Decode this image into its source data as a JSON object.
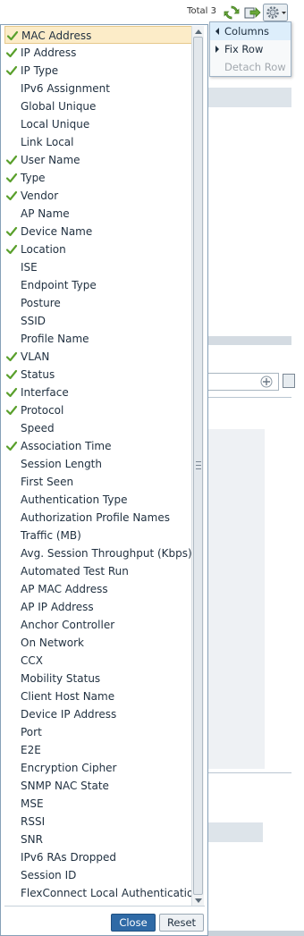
{
  "toolbar": {
    "total_label": "Total 3",
    "icons": [
      "refresh-icon",
      "export-icon",
      "gear-icon"
    ]
  },
  "colors": {
    "check": "#5aa02c",
    "selected_row": "#fcecc8",
    "close_button": "#2f6aa6",
    "menu_highlight": "#ddeefb"
  },
  "menu": {
    "items": [
      {
        "label": "Columns",
        "state": "active"
      },
      {
        "label": "Fix Row",
        "state": "normal"
      },
      {
        "label": "Detach Row",
        "state": "disabled"
      }
    ]
  },
  "columns": [
    {
      "label": "MAC Address",
      "checked": true,
      "selected": true
    },
    {
      "label": "IP Address",
      "checked": true
    },
    {
      "label": "IP Type",
      "checked": true
    },
    {
      "label": "IPv6 Assignment",
      "checked": false
    },
    {
      "label": "Global Unique",
      "checked": false
    },
    {
      "label": "Local Unique",
      "checked": false
    },
    {
      "label": "Link Local",
      "checked": false
    },
    {
      "label": "User Name",
      "checked": true
    },
    {
      "label": "Type",
      "checked": true
    },
    {
      "label": "Vendor",
      "checked": true
    },
    {
      "label": "AP Name",
      "checked": false
    },
    {
      "label": "Device Name",
      "checked": true
    },
    {
      "label": "Location",
      "checked": true
    },
    {
      "label": "ISE",
      "checked": false
    },
    {
      "label": "Endpoint Type",
      "checked": false
    },
    {
      "label": "Posture",
      "checked": false
    },
    {
      "label": "SSID",
      "checked": false
    },
    {
      "label": "Profile Name",
      "checked": false
    },
    {
      "label": "VLAN",
      "checked": true
    },
    {
      "label": "Status",
      "checked": true
    },
    {
      "label": "Interface",
      "checked": true
    },
    {
      "label": "Protocol",
      "checked": true
    },
    {
      "label": "Speed",
      "checked": false
    },
    {
      "label": "Association Time",
      "checked": true
    },
    {
      "label": "Session Length",
      "checked": false
    },
    {
      "label": "First Seen",
      "checked": false
    },
    {
      "label": "Authentication Type",
      "checked": false
    },
    {
      "label": "Authorization Profile Names",
      "checked": false
    },
    {
      "label": "Traffic (MB)",
      "checked": false
    },
    {
      "label": "Avg. Session Throughput (Kbps)",
      "checked": false
    },
    {
      "label": "Automated Test Run",
      "checked": false
    },
    {
      "label": "AP MAC Address",
      "checked": false
    },
    {
      "label": "AP IP Address",
      "checked": false
    },
    {
      "label": "Anchor Controller",
      "checked": false
    },
    {
      "label": "On Network",
      "checked": false
    },
    {
      "label": "CCX",
      "checked": false
    },
    {
      "label": "Mobility Status",
      "checked": false
    },
    {
      "label": "Client Host Name",
      "checked": false
    },
    {
      "label": "Device IP Address",
      "checked": false
    },
    {
      "label": "Port",
      "checked": false
    },
    {
      "label": "E2E",
      "checked": false
    },
    {
      "label": "Encryption Cipher",
      "checked": false
    },
    {
      "label": "SNMP NAC State",
      "checked": false
    },
    {
      "label": "MSE",
      "checked": false
    },
    {
      "label": "RSSI",
      "checked": false
    },
    {
      "label": "SNR",
      "checked": false
    },
    {
      "label": "IPv6 RAs Dropped",
      "checked": false
    },
    {
      "label": "Session ID",
      "checked": false
    },
    {
      "label": "FlexConnect Local Authentication",
      "checked": false
    }
  ],
  "buttons": {
    "close": "Close",
    "reset": "Reset"
  },
  "figure_number": "292805"
}
